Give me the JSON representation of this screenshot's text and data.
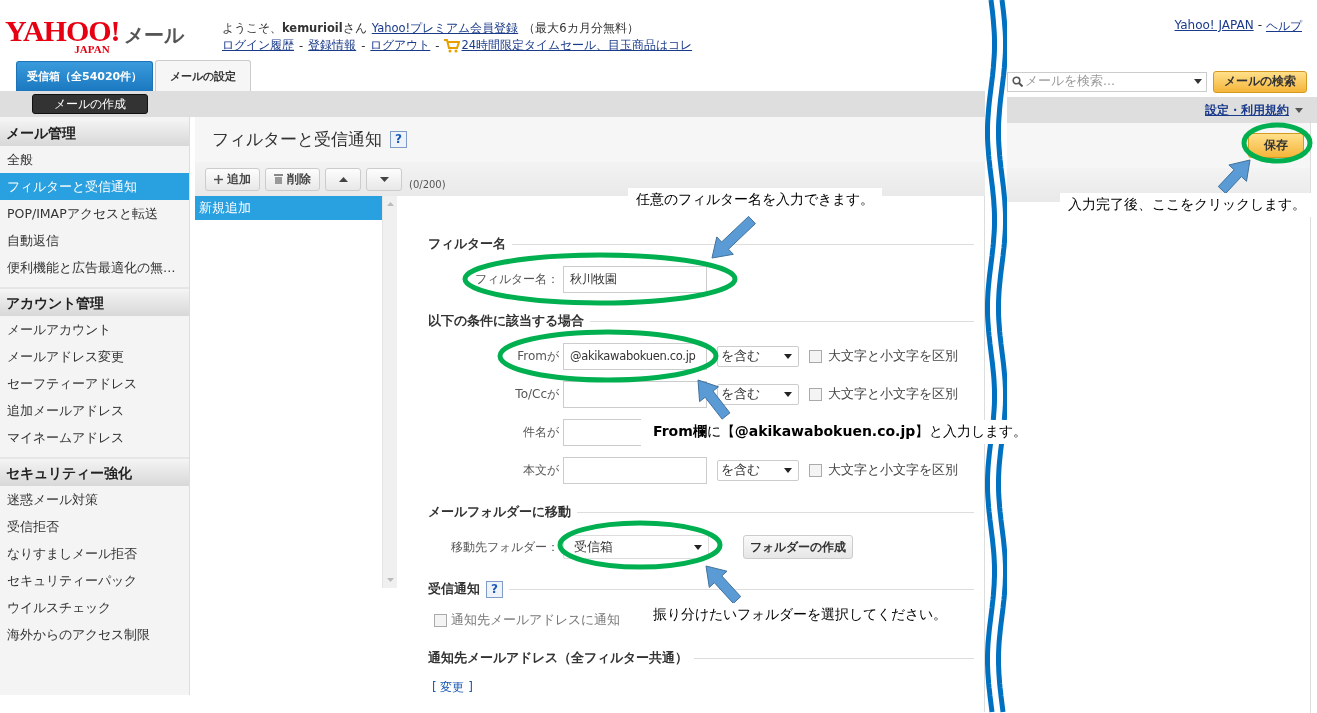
{
  "header": {
    "logo": {
      "brand": "YAHOO!",
      "region": "JAPAN",
      "service": "メール"
    },
    "welcome": "ようこそ、**kemurioil**さん",
    "premium_link": "Yahoo!プレミアム会員登録",
    "premium_note": "（最大6カ月分無料）",
    "account_links": [
      "ログイン履歴",
      "登録情報",
      "ログアウト"
    ],
    "separator": "-",
    "sale_link": "24時間限定タイムセール、目玉商品はコレ",
    "top_links": [
      "Yahoo! JAPAN",
      "ヘルプ"
    ]
  },
  "tabs": [
    {
      "label": "受信箱（全54020件）",
      "selected": false
    },
    {
      "label": "メールの設定",
      "selected": true
    }
  ],
  "search": {
    "placeholder": "メールを検索...",
    "button": "メールの検索"
  },
  "compose_button": "メールの作成",
  "settings_menu": "設定・利用規約",
  "sidebar": {
    "groups": [
      {
        "title": "メール管理",
        "items": [
          {
            "label": "全般",
            "selected": false
          },
          {
            "label": "フィルターと受信通知",
            "selected": true
          },
          {
            "label": "POP/IMAPアクセスと転送",
            "selected": false
          },
          {
            "label": "自動返信",
            "selected": false
          },
          {
            "label": "便利機能と広告最適化の無…",
            "selected": false
          }
        ]
      },
      {
        "title": "アカウント管理",
        "items": [
          {
            "label": "メールアカウント",
            "selected": false
          },
          {
            "label": "メールアドレス変更",
            "selected": false
          },
          {
            "label": "セーフティーアドレス",
            "selected": false
          },
          {
            "label": "追加メールアドレス",
            "selected": false
          },
          {
            "label": "マイネームアドレス",
            "selected": false
          }
        ]
      },
      {
        "title": "セキュリティー強化",
        "items": [
          {
            "label": "迷惑メール対策",
            "selected": false
          },
          {
            "label": "受信拒否",
            "selected": false
          },
          {
            "label": "なりすましメール拒否",
            "selected": false
          },
          {
            "label": "セキュリティーパック",
            "selected": false
          },
          {
            "label": "ウイルスチェック",
            "selected": false
          },
          {
            "label": "海外からのアクセス制限",
            "selected": false
          }
        ]
      }
    ]
  },
  "page": {
    "title": "フィルターと受信通知",
    "help": "?",
    "save_button": "保存"
  },
  "toolbar": {
    "buttons": [
      {
        "kind": "add",
        "label": "追加"
      },
      {
        "kind": "delete",
        "label": "削除"
      },
      {
        "kind": "up"
      },
      {
        "kind": "down"
      }
    ],
    "count": "(0/200)"
  },
  "filters": [
    {
      "label": "新規追加",
      "selected": true
    }
  ],
  "form": {
    "sections": [
      {
        "title": "フィルター名",
        "rows": [
          {
            "kind": "text",
            "label": "フィルター名：",
            "value": "秋川牧園"
          }
        ]
      },
      {
        "title": "以下の条件に該当する場合",
        "rows": [
          {
            "kind": "condition",
            "label": "Fromが",
            "value": "@akikawabokuen.co.jp",
            "operator": "を含む",
            "case_label": "大文字と小文字を区別",
            "case_checked": false
          },
          {
            "kind": "condition",
            "label": "To/Ccが",
            "operator": "を含む",
            "case_label": "大文字と小文字を区別",
            "case_checked": false
          },
          {
            "kind": "condition",
            "label": "件名が"
          },
          {
            "kind": "condition",
            "label": "本文が",
            "operator": "を含む",
            "case_label": "大文字と小文字を区別",
            "case_checked": false
          }
        ]
      },
      {
        "title": "メールフォルダーに移動",
        "rows": [
          {
            "kind": "folder",
            "label": "移動先フォルダー：",
            "value": "受信箱",
            "button": "フォルダーの作成"
          }
        ]
      },
      {
        "title": "受信通知",
        "help": "?",
        "rows": [
          {
            "kind": "check",
            "label": "通知先メールアドレスに通知",
            "checked": false,
            "disabled": true
          }
        ]
      },
      {
        "title": "通知先メールアドレス（全フィルター共通）",
        "rows": [
          {
            "kind": "link",
            "label": "[ 変更 ]"
          }
        ]
      }
    ]
  },
  "annotations": [
    {
      "kind": "callout",
      "text": "任意のフィルター名を入力できます。"
    },
    {
      "kind": "callout",
      "text": "入力完了後、ここをクリックします。"
    },
    {
      "kind": "callout",
      "text": "**From欄**に【**@akikawabokuen.co.jp**】と入力します。"
    },
    {
      "kind": "callout",
      "text": "振り分けたいフォルダーを選択してください。"
    }
  ]
}
